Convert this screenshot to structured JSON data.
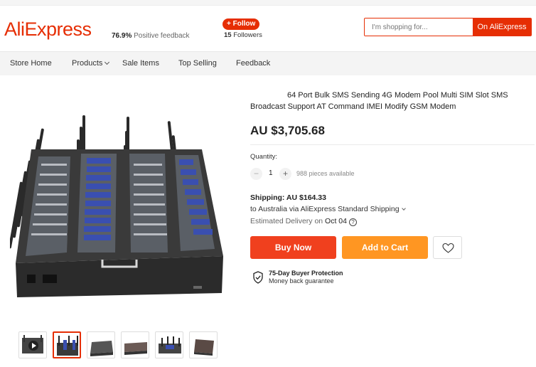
{
  "header": {
    "logo": "AliExpress",
    "feedback_value": "76.9%",
    "feedback_label": "Positive feedback",
    "follow_label": "+ Follow",
    "followers_count": "15",
    "followers_label": "Followers",
    "search_placeholder": "I'm shopping for...",
    "search_button": "On AliExpress"
  },
  "nav": {
    "items": [
      "Store Home",
      "Products",
      "Sale Items",
      "Top Selling",
      "Feedback"
    ]
  },
  "product": {
    "title": "64 Port Bulk SMS Sending 4G Modem Pool Multi SIM Slot SMS Broadcast Support AT Command IMEI Modify GSM Modem",
    "price": "AU $3,705.68",
    "quantity_label": "Quantity:",
    "quantity_minus": "−",
    "quantity_value": "1",
    "quantity_plus": "+",
    "available": "988 pieces available",
    "shipping_cost": "Shipping: AU $164.33",
    "shipping_method": "to Australia via AliExpress Standard Shipping",
    "delivery_label": "Estimated Delivery on",
    "delivery_date": "Oct 04",
    "buy_now": "Buy Now",
    "add_to_cart": "Add to Cart",
    "protection_title": "75-Day Buyer Protection",
    "protection_sub": "Money back guarantee"
  },
  "thumbnails": [
    "video",
    "image-2",
    "image-3",
    "image-4",
    "image-5",
    "image-6"
  ],
  "icons": [
    "play-icon",
    "heart-icon",
    "shield-check-icon",
    "help-icon",
    "chevron-down-icon"
  ],
  "colors": {
    "brand": "#e62e04",
    "buy": "#f0401e",
    "cart": "#ff9622"
  }
}
